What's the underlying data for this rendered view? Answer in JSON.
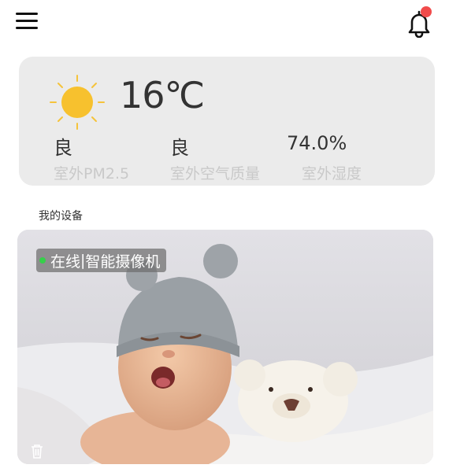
{
  "header": {
    "menu_icon": "hamburger-menu-icon",
    "bell_icon": "bell-icon",
    "has_notification": true,
    "notification_color": "#f14b4b"
  },
  "weather": {
    "icon": "sun-icon",
    "temperature": "16℃",
    "metrics": [
      {
        "value": "良",
        "label": "室外PM2.5"
      },
      {
        "value": "良",
        "label": "室外空气质量"
      },
      {
        "value": "74.0%",
        "label": "室外湿度"
      }
    ]
  },
  "devices": {
    "section_title": "我的设备",
    "items": [
      {
        "status_text": "在线",
        "separator": "|",
        "name": "智能摄像机",
        "status_color": "#35d04a",
        "delete_icon": "trash-icon"
      }
    ]
  }
}
